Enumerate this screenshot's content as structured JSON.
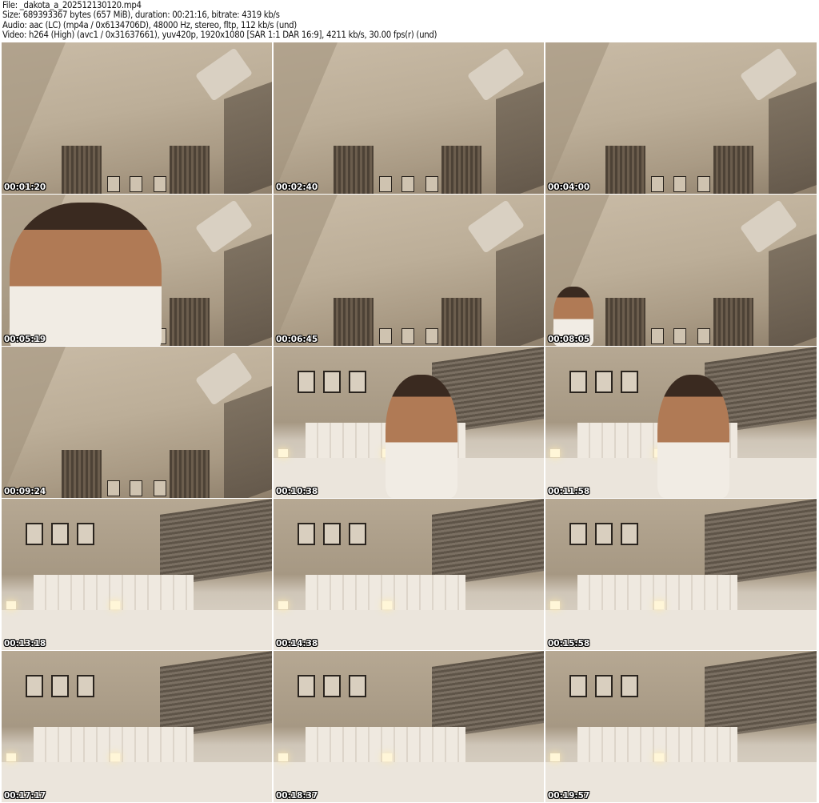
{
  "header": {
    "file": "File: _dakota_a_202512130120.mp4",
    "size": "Size: 689393367 bytes (657 MiB), duration: 00:21:16, bitrate: 4319 kb/s",
    "audio": "Audio: aac (LC) (mp4a / 0x6134706D), 48000 Hz, stereo, fltp, 112 kb/s (und)",
    "video": "Video: h264 (High) (avc1 / 0x31637661), yuv420p, 1920x1080 [SAR 1:1 DAR 16:9], 4211 kb/s, 30.00 fps(r) (und)"
  },
  "thumbnails": [
    {
      "timestamp": "00:01:20",
      "scene": "ceiling"
    },
    {
      "timestamp": "00:02:40",
      "scene": "ceiling"
    },
    {
      "timestamp": "00:04:00",
      "scene": "ceiling"
    },
    {
      "timestamp": "00:05:19",
      "scene": "ceiling-person-large"
    },
    {
      "timestamp": "00:06:45",
      "scene": "ceiling"
    },
    {
      "timestamp": "00:08:05",
      "scene": "ceiling-person-small"
    },
    {
      "timestamp": "00:09:24",
      "scene": "ceiling"
    },
    {
      "timestamp": "00:10:38",
      "scene": "room-person"
    },
    {
      "timestamp": "00:11:58",
      "scene": "room-person"
    },
    {
      "timestamp": "00:13:18",
      "scene": "room"
    },
    {
      "timestamp": "00:14:38",
      "scene": "room"
    },
    {
      "timestamp": "00:15:58",
      "scene": "room"
    },
    {
      "timestamp": "00:17:17",
      "scene": "room"
    },
    {
      "timestamp": "00:18:37",
      "scene": "room"
    },
    {
      "timestamp": "00:19:57",
      "scene": "room"
    }
  ]
}
